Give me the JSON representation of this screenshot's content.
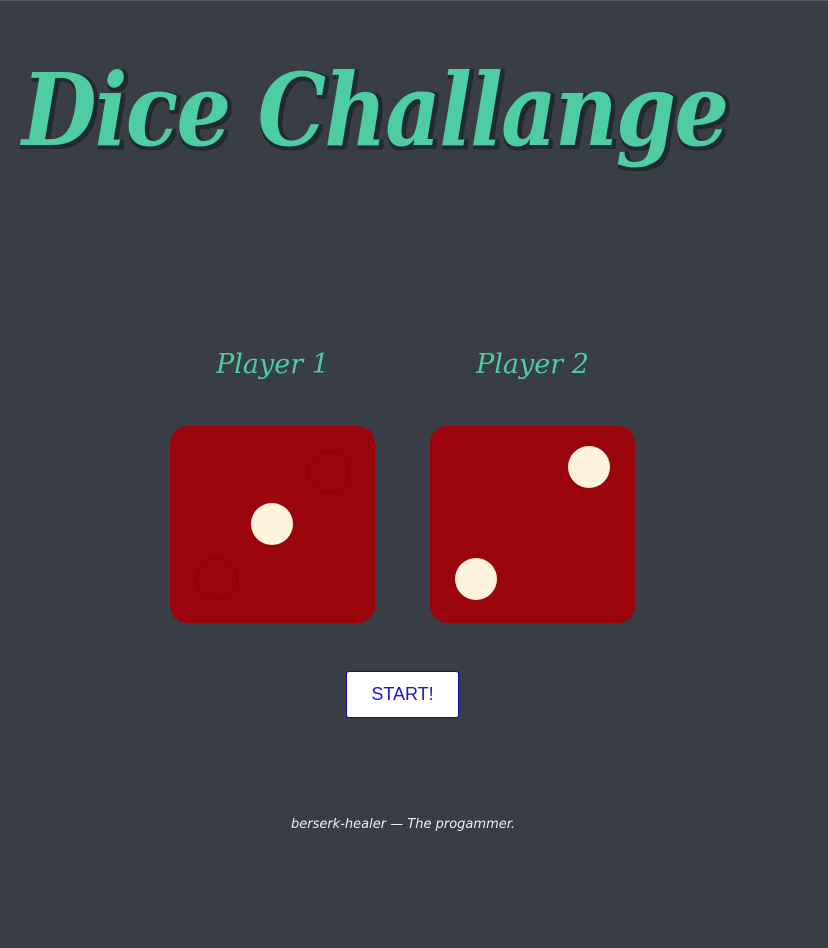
{
  "app": {
    "title": "Dice Challange"
  },
  "players": [
    {
      "label": "Player 1",
      "die_value": 2
    },
    {
      "label": "Player 2",
      "die_value": 2
    }
  ],
  "controls": {
    "start_label": "START!"
  },
  "footer": {
    "text": "berserk-healer — The progammer."
  },
  "colors": {
    "background": "#393E46",
    "accent": "#4ECCA3",
    "title_shadow": "#232931",
    "die": "#9A040C",
    "pip": "#FEF3DD",
    "footer_text": "#EEEEEE"
  }
}
